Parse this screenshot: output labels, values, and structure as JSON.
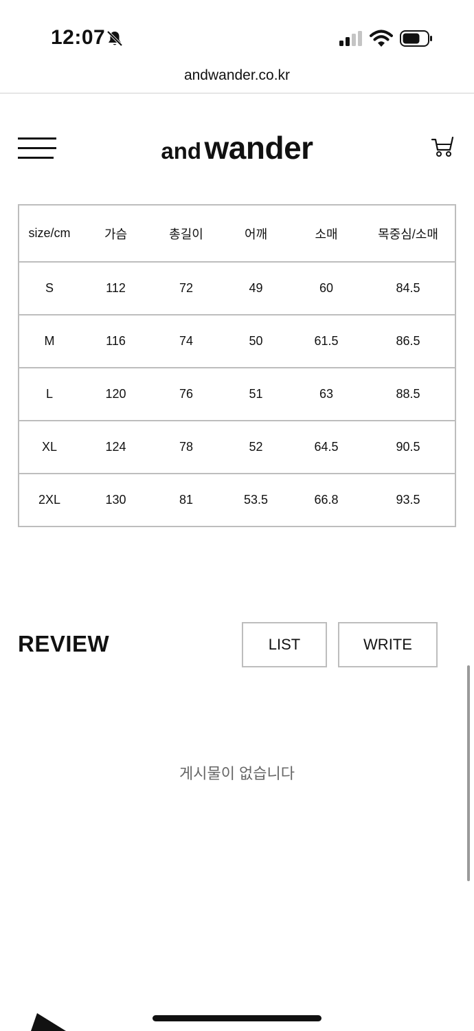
{
  "status_bar": {
    "time": "12:07",
    "icons": [
      "bell-off-icon",
      "cellular-signal-icon",
      "wifi-icon",
      "battery-icon"
    ]
  },
  "browser": {
    "url": "andwander.co.kr"
  },
  "header": {
    "logo_and": "and",
    "logo_wander": "wander",
    "icons": [
      "hamburger-menu-icon",
      "cart-icon"
    ]
  },
  "size_table": {
    "headers": [
      "size/cm",
      "가슴",
      "총길이",
      "어깨",
      "소매",
      "목중심/소매"
    ],
    "rows": [
      [
        "S",
        "112",
        "72",
        "49",
        "60",
        "84.5"
      ],
      [
        "M",
        "116",
        "74",
        "50",
        "61.5",
        "86.5"
      ],
      [
        "L",
        "120",
        "76",
        "51",
        "63",
        "88.5"
      ],
      [
        "XL",
        "124",
        "78",
        "52",
        "64.5",
        "90.5"
      ],
      [
        "2XL",
        "130",
        "81",
        "53.5",
        "66.8",
        "93.5"
      ]
    ]
  },
  "review": {
    "title": "REVIEW",
    "list_label": "LIST",
    "write_label": "WRITE",
    "empty_message": "게시물이 없습니다"
  },
  "colors": {
    "text": "#111111",
    "border": "#bdbdbd",
    "muted": "#666666",
    "background": "#ffffff"
  }
}
